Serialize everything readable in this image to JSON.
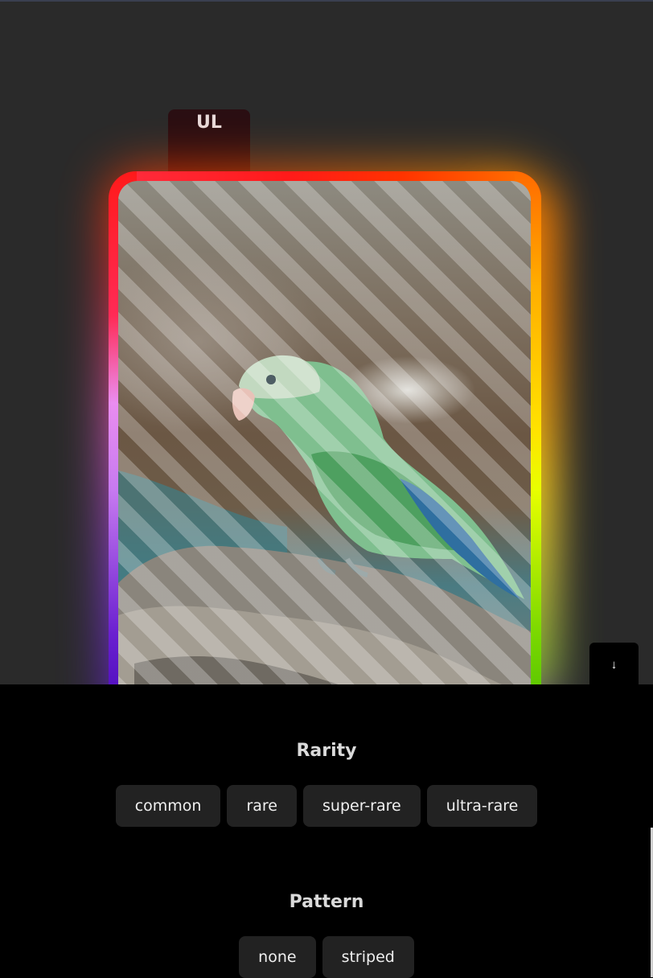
{
  "card": {
    "badge": "UL",
    "image_subject": "parrot-on-rock",
    "pattern_overlay": "striped"
  },
  "scroll_button": {
    "icon": "arrow-down-icon",
    "glyph": "↓"
  },
  "rarity": {
    "title": "Rarity",
    "options": [
      "common",
      "rare",
      "super-rare",
      "ultra-rare"
    ]
  },
  "pattern": {
    "title": "Pattern",
    "options": [
      "none",
      "striped"
    ]
  },
  "colors": {
    "stage_bg": "#2a2a2a",
    "controls_bg": "#000000",
    "chip_bg": "#222222",
    "frame_rainbow": [
      "#ff1a1a",
      "#ff6a00",
      "#ffe300",
      "#68d400",
      "#3a00b0",
      "#ea8df0"
    ]
  }
}
